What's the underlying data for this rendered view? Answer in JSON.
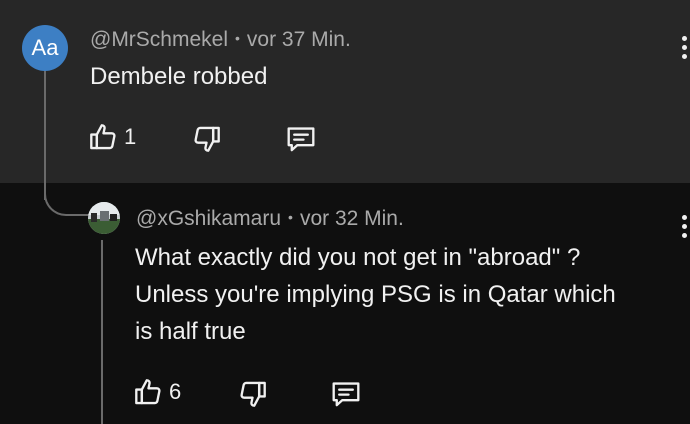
{
  "comments": [
    {
      "avatar_text": "Aa",
      "avatar_color": "#3d7fc4",
      "author": "@MrSchmekel",
      "separator": "•",
      "time": "vor 37 Min.",
      "text": "Dembele robbed",
      "likes": "1",
      "icons": [
        "thumbs-up-icon",
        "thumbs-down-icon",
        "reply-comment-icon",
        "more-vertical-icon"
      ]
    },
    {
      "author": "@xGshikamaru",
      "separator": "•",
      "time": "vor 32 Min.",
      "text_lines": [
        "What exactly did you not get in \"abroad\" ?",
        "Unless you're implying PSG is in Qatar which",
        "is half true"
      ],
      "likes": "6",
      "icons": [
        "thumbs-up-icon",
        "thumbs-down-icon",
        "reply-comment-icon",
        "more-vertical-icon"
      ]
    }
  ],
  "colors": {
    "top_background": "#272727",
    "bottom_background": "#0f0f0f",
    "meta_text": "#aaaaaa",
    "primary_text": "#f1f1f1"
  }
}
